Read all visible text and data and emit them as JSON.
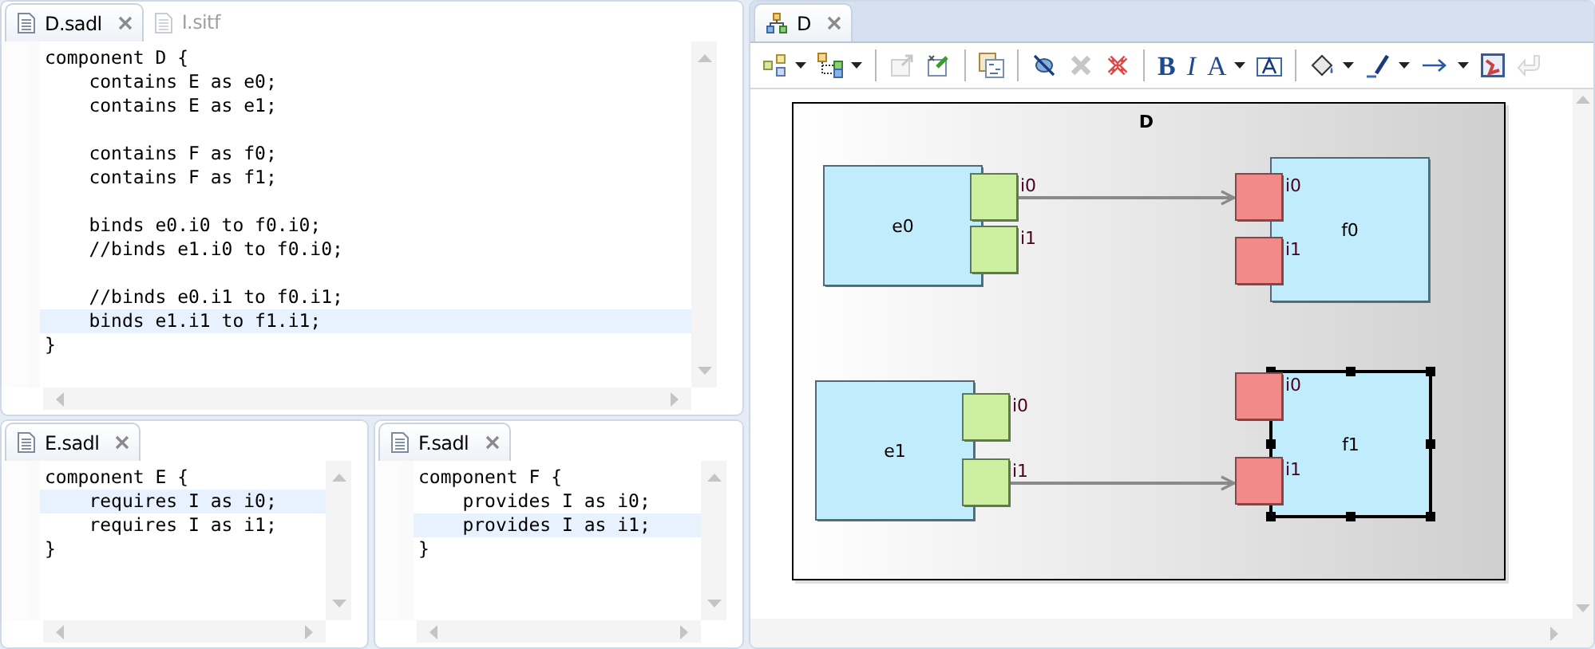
{
  "editors": [
    {
      "tabs": [
        {
          "label": "D.sadl",
          "selected": true,
          "closable": true
        },
        {
          "label": "I.sitf",
          "selected": false,
          "closable": false
        }
      ],
      "lines": [
        {
          "kind": "code",
          "text": "component D {",
          "highlighted": false
        },
        {
          "kind": "code",
          "text": "    contains E as e0;",
          "highlighted": false
        },
        {
          "kind": "code",
          "text": "    contains E as e1;",
          "highlighted": false
        },
        {
          "kind": "blank"
        },
        {
          "kind": "code",
          "text": "    contains F as f0;",
          "highlighted": false
        },
        {
          "kind": "code",
          "text": "    contains F as f1;",
          "highlighted": false
        },
        {
          "kind": "blank"
        },
        {
          "kind": "code",
          "text": "    binds e0.i0 to f0.i0;",
          "highlighted": false
        },
        {
          "kind": "code",
          "text": "    //binds e1.i0 to f0.i0;",
          "highlighted": false
        },
        {
          "kind": "blank"
        },
        {
          "kind": "code",
          "text": "    //binds e0.i1 to f0.i1;",
          "highlighted": false
        },
        {
          "kind": "code",
          "text": "    binds e1.i1 to f1.i1;",
          "highlighted": true
        },
        {
          "kind": "code",
          "text": "}",
          "highlighted": false
        }
      ]
    },
    {
      "tabs": [
        {
          "label": "E.sadl",
          "selected": true,
          "closable": true
        }
      ],
      "lines": [
        {
          "kind": "code",
          "text": "component E {",
          "highlighted": false
        },
        {
          "kind": "code",
          "text": "    requires I as i0;",
          "highlighted": true
        },
        {
          "kind": "code",
          "text": "    requires I as i1;",
          "highlighted": false
        },
        {
          "kind": "code",
          "text": "}",
          "highlighted": false
        }
      ]
    },
    {
      "tabs": [
        {
          "label": "F.sadl",
          "selected": true,
          "closable": true
        }
      ],
      "lines": [
        {
          "kind": "code",
          "text": "component F {",
          "highlighted": false
        },
        {
          "kind": "code",
          "text": "    provides I as i0;",
          "highlighted": false
        },
        {
          "kind": "code",
          "text": "    provides I as i1;",
          "highlighted": true
        },
        {
          "kind": "code",
          "text": "}",
          "highlighted": false
        }
      ]
    }
  ],
  "diagram_editor": {
    "tabs": [
      {
        "label": "D",
        "selected": true,
        "closable": true
      }
    ],
    "toolbar": [
      {
        "kind": "shapes",
        "dropdown": true,
        "disabled": false
      },
      {
        "kind": "tree",
        "dropdown": true,
        "disabled": false
      },
      {
        "kind": "separator"
      },
      {
        "kind": "export",
        "dropdown": false,
        "disabled": true
      },
      {
        "kind": "pin",
        "dropdown": false,
        "disabled": false
      },
      {
        "kind": "separator"
      },
      {
        "kind": "layout",
        "dropdown": false,
        "disabled": false
      },
      {
        "kind": "separator"
      },
      {
        "kind": "hide",
        "dropdown": false,
        "disabled": false
      },
      {
        "kind": "delete",
        "dropdown": false,
        "disabled": true
      },
      {
        "kind": "delete-model",
        "dropdown": false,
        "disabled": false
      },
      {
        "kind": "separator"
      },
      {
        "kind": "bold",
        "text": "B",
        "dropdown": false,
        "disabled": false
      },
      {
        "kind": "italic",
        "text": "I",
        "dropdown": false,
        "disabled": false
      },
      {
        "kind": "font",
        "text": "A",
        "dropdown": true,
        "disabled": false
      },
      {
        "kind": "textbox",
        "dropdown": false,
        "disabled": false
      },
      {
        "kind": "separator"
      },
      {
        "kind": "fill",
        "dropdown": true,
        "disabled": false
      },
      {
        "kind": "line",
        "dropdown": true,
        "disabled": false
      },
      {
        "kind": "arrow",
        "dropdown": true,
        "disabled": false
      },
      {
        "kind": "image",
        "dropdown": false,
        "disabled": false
      },
      {
        "kind": "undo",
        "dropdown": false,
        "disabled": true
      }
    ],
    "diagram": {
      "title": "D",
      "nodes": [
        {
          "label": "e0",
          "selected": false,
          "ports": [
            {
              "label": "i0",
              "kind": "required",
              "bound": true
            },
            {
              "label": "i1",
              "kind": "required",
              "bound": false
            }
          ]
        },
        {
          "label": "e1",
          "selected": false,
          "ports": [
            {
              "label": "i0",
              "kind": "required",
              "bound": false
            },
            {
              "label": "i1",
              "kind": "required",
              "bound": true
            }
          ]
        },
        {
          "label": "f0",
          "selected": false,
          "ports": [
            {
              "label": "i0",
              "kind": "provided",
              "bound": false
            },
            {
              "label": "i1",
              "kind": "provided",
              "bound": false
            }
          ]
        },
        {
          "label": "f1",
          "selected": true,
          "ports": [
            {
              "label": "i0",
              "kind": "provided",
              "bound": false
            },
            {
              "label": "i1",
              "kind": "provided",
              "bound": false
            }
          ]
        }
      ]
    }
  }
}
